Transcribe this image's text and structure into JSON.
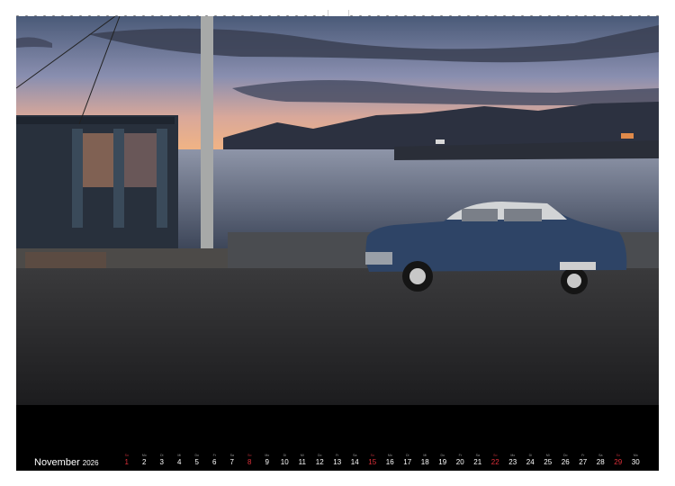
{
  "calendar": {
    "month": "November",
    "year": "2026",
    "days": [
      {
        "wd": "So",
        "num": "1",
        "red": true
      },
      {
        "wd": "Mo",
        "num": "2",
        "red": false
      },
      {
        "wd": "Di",
        "num": "3",
        "red": false
      },
      {
        "wd": "Mi",
        "num": "4",
        "red": false
      },
      {
        "wd": "Do",
        "num": "5",
        "red": false
      },
      {
        "wd": "Fr",
        "num": "6",
        "red": false
      },
      {
        "wd": "Sa",
        "num": "7",
        "red": false
      },
      {
        "wd": "So",
        "num": "8",
        "red": true
      },
      {
        "wd": "Mo",
        "num": "9",
        "red": false
      },
      {
        "wd": "Di",
        "num": "10",
        "red": false
      },
      {
        "wd": "Mi",
        "num": "11",
        "red": false
      },
      {
        "wd": "Do",
        "num": "12",
        "red": false
      },
      {
        "wd": "Fr",
        "num": "13",
        "red": false
      },
      {
        "wd": "Sa",
        "num": "14",
        "red": false
      },
      {
        "wd": "So",
        "num": "15",
        "red": true
      },
      {
        "wd": "Mo",
        "num": "16",
        "red": false
      },
      {
        "wd": "Di",
        "num": "17",
        "red": false
      },
      {
        "wd": "Mi",
        "num": "18",
        "red": false
      },
      {
        "wd": "Do",
        "num": "19",
        "red": false
      },
      {
        "wd": "Fr",
        "num": "20",
        "red": false
      },
      {
        "wd": "Sa",
        "num": "21",
        "red": false
      },
      {
        "wd": "So",
        "num": "22",
        "red": true
      },
      {
        "wd": "Mo",
        "num": "23",
        "red": false
      },
      {
        "wd": "Di",
        "num": "24",
        "red": false
      },
      {
        "wd": "Mi",
        "num": "25",
        "red": false
      },
      {
        "wd": "Do",
        "num": "26",
        "red": false
      },
      {
        "wd": "Fr",
        "num": "27",
        "red": false
      },
      {
        "wd": "Sa",
        "num": "28",
        "red": false
      },
      {
        "wd": "So",
        "num": "29",
        "red": true
      },
      {
        "wd": "Mo",
        "num": "30",
        "red": false
      }
    ]
  },
  "colors": {
    "sunday": "#e0303a",
    "text": "#ffffff",
    "background": "#000000"
  }
}
